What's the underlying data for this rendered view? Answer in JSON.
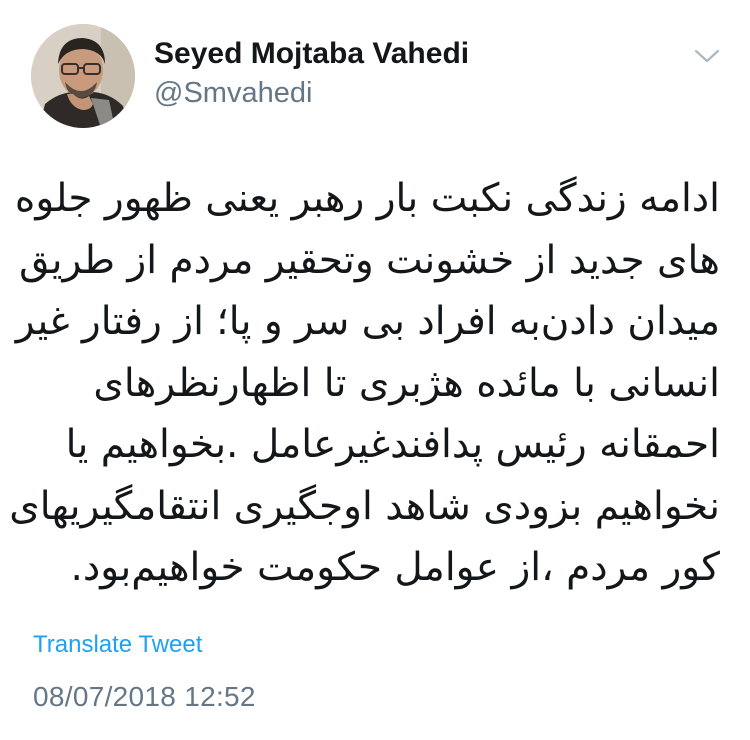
{
  "author": {
    "display_name": "Seyed Mojtaba Vahedi",
    "handle": "@Smvahedi",
    "avatar": "profile-photo"
  },
  "header": {
    "menu_icon": "chevron-down-icon"
  },
  "tweet": {
    "lines": [
      "ادامه زندگی نکبت بار رهبر یعنی ظهور جلوه",
      "های جدید از خشونت وتحقیر مردم از طریق",
      "میدان دادن‌به افراد بی سر و پا؛ از رفتار غیر",
      "انسانی با مائده هژبری تا اظهارنظرهای",
      "احمقانه رئیس پدافندغیرعامل .بخواهیم یا",
      "نخواهیم بزودی شاهد اوجگیری انتقامگیریهای",
      "کور مردم ،از عوامل حکومت خواهیم‌بود."
    ]
  },
  "actions": {
    "translate_label": "Translate Tweet"
  },
  "meta": {
    "timestamp": "08/07/2018 12:52"
  },
  "colors": {
    "link": "#1da1f2",
    "secondary_text": "#657786",
    "primary_text": "#14171a"
  }
}
